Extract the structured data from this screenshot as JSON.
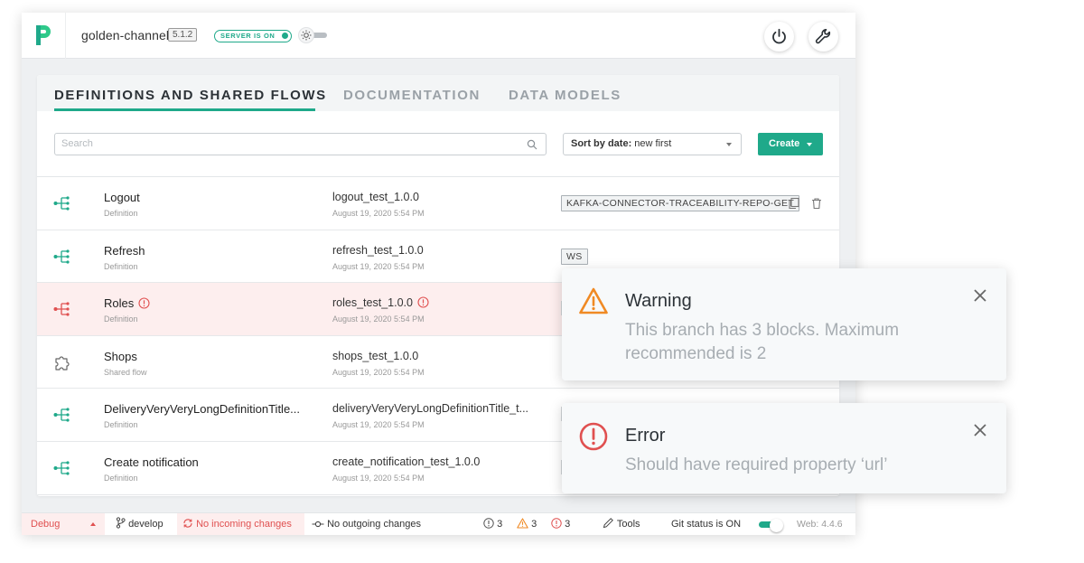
{
  "header": {
    "channel_name": "golden-channel",
    "version": "5.1.2",
    "server_status": "SERVER IS ON"
  },
  "tabs": [
    {
      "label": "DEFINITIONS AND SHARED FLOWS",
      "active": true
    },
    {
      "label": "DOCUMENTATION",
      "active": false
    },
    {
      "label": "DATA MODELS",
      "active": false
    }
  ],
  "toolbar": {
    "search_placeholder": "Search",
    "sort_label": "Sort by date:",
    "sort_value": "new first",
    "create_label": "Create"
  },
  "rows": [
    {
      "title": "Logout",
      "subtitle": "Definition",
      "file": "logout_test_1.0.0",
      "date": "August 19, 2020 5:54 PM",
      "tag": "KAFKA-CONNECTOR-TRACEABILITY-REPO-GET",
      "icon": "flow-definition-icon",
      "error": false
    },
    {
      "title": "Refresh",
      "subtitle": "Definition",
      "file": "refresh_test_1.0.0",
      "date": "August 19, 2020 5:54 PM",
      "tag": "WS",
      "icon": "flow-definition-icon",
      "error": false
    },
    {
      "title": "Roles",
      "subtitle": "Definition",
      "file": "roles_test_1.0.0",
      "date": "August 19, 2020 5:54 PM",
      "tag": "",
      "icon": "flow-definition-icon",
      "error": true
    },
    {
      "title": "Shops",
      "subtitle": "Shared flow",
      "file": "shops_test_1.0.0",
      "date": "August 19, 2020 5:54 PM",
      "tag": "",
      "icon": "puzzle-icon",
      "error": false
    },
    {
      "title": "DeliveryVeryVeryLongDefinitionTitle...",
      "subtitle": "Definition",
      "file": "deliveryVeryVeryLongDefinitionTitle_t...",
      "date": "August 19, 2020 5:54 PM",
      "tag": "",
      "icon": "flow-definition-icon",
      "error": false
    },
    {
      "title": "Create notification",
      "subtitle": "Definition",
      "file": "create_notification_test_1.0.0",
      "date": "August 19, 2020 5:54 PM",
      "tag": "",
      "icon": "flow-definition-icon",
      "error": false
    }
  ],
  "statusbar": {
    "mode": "Debug",
    "branch": "develop",
    "incoming": "No incoming changes",
    "outgoing": "No outgoing changes",
    "info_count": "3",
    "warning_count": "3",
    "error_count": "3",
    "tools_label": "Tools",
    "git_status": "Git status is ON",
    "web_version": "Web: 4.4.6"
  },
  "toasts": {
    "warning": {
      "title": "Warning",
      "message": "This branch has 3 blocks. Maximum recommended is 2"
    },
    "error": {
      "title": "Error",
      "message": "Should have required property ‘url’"
    }
  },
  "colors": {
    "accent": "#1fa98a",
    "error": "#e05050",
    "warning": "#f08a24"
  }
}
